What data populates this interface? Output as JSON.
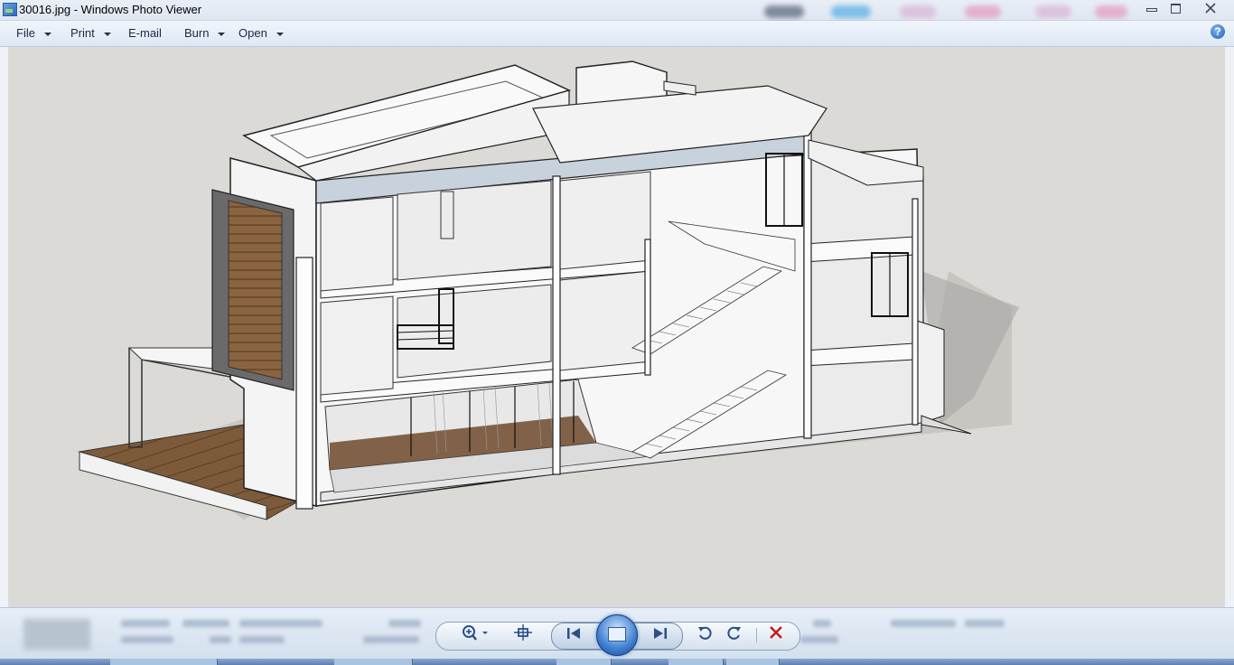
{
  "window": {
    "title": "30016.jpg - Windows Photo Viewer",
    "controls": {
      "minimize": "minimize",
      "maximize": "restore",
      "close": "close"
    }
  },
  "menu": {
    "items": [
      {
        "label": "File",
        "has_dropdown": true
      },
      {
        "label": "Print",
        "has_dropdown": true
      },
      {
        "label": "E-mail",
        "has_dropdown": false
      },
      {
        "label": "Burn",
        "has_dropdown": true
      },
      {
        "label": "Open",
        "has_dropdown": true
      }
    ],
    "help_label": "?"
  },
  "viewer": {
    "image_subject": "architectural sectional 3D model of a three-storey house",
    "background_color": "#dcdad6"
  },
  "toolbar": {
    "buttons": [
      {
        "name": "zoom",
        "icon": "zoom-in-icon"
      },
      {
        "name": "actual-size",
        "icon": "fit-to-window-icon"
      },
      {
        "name": "previous",
        "icon": "previous-icon"
      },
      {
        "name": "slideshow",
        "icon": "slideshow-icon"
      },
      {
        "name": "next",
        "icon": "next-icon"
      },
      {
        "name": "rotate-counterclockwise",
        "icon": "rotate-left-icon"
      },
      {
        "name": "rotate-clockwise",
        "icon": "rotate-right-icon"
      },
      {
        "name": "delete",
        "icon": "delete-icon"
      }
    ]
  },
  "colors": {
    "accent": "#2a4f86",
    "delete": "#c0201a",
    "wood": "#8a6440"
  }
}
